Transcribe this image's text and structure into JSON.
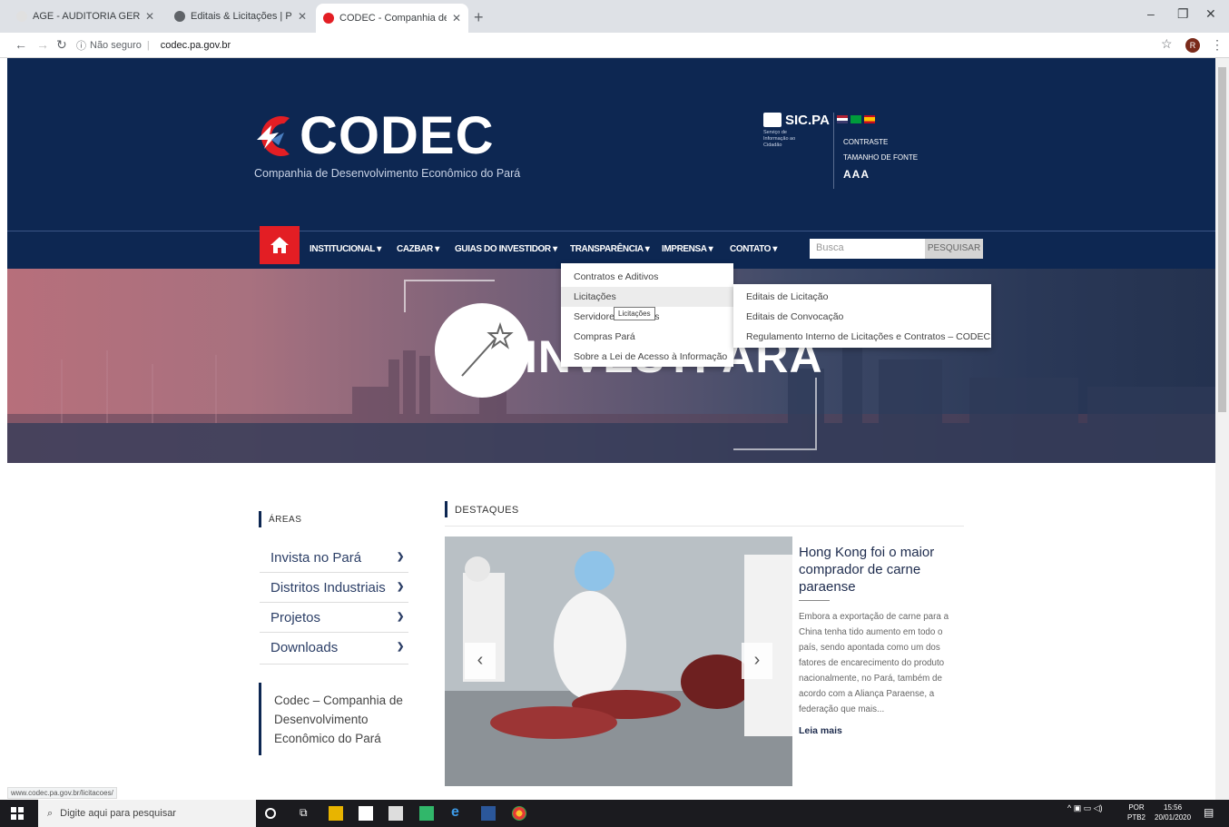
{
  "browser": {
    "tabs": [
      {
        "title": "AGE - AUDITORIA GERAL DO ES"
      },
      {
        "title": "Editais & Licitações | Portal da Tr"
      },
      {
        "title": "CODEC - Companhia de Desenv"
      }
    ],
    "insecure_label": "Não seguro",
    "url": "codec.pa.gov.br",
    "profile_initial": "R",
    "status_url": "www.codec.pa.gov.br/licitacoes/"
  },
  "header": {
    "logo_text": "CODEC",
    "logo_subtitle": "Companhia de Desenvolvimento Econômico do Pará",
    "sic_title": "SIC.PA",
    "sic_sub": "Serviço de Informação ao Cidadão",
    "contrast_label": "CONTRASTE",
    "fontsize_label": "TAMANHO DE FONTE",
    "font_aa": "AAA"
  },
  "nav": {
    "items": [
      {
        "label": "INSTITUCIONAL"
      },
      {
        "label": "CAZBAR"
      },
      {
        "label": "GUIAS DO INVESTIDOR"
      },
      {
        "label": "TRANSPARÊNCIA"
      },
      {
        "label": "IMPRENSA"
      },
      {
        "label": "CONTATO"
      }
    ],
    "search_placeholder": "Busca",
    "search_button": "PESQUISAR"
  },
  "dropdown": {
    "items": [
      {
        "label": "Contratos e Aditivos"
      },
      {
        "label": "Licitações"
      },
      {
        "label": "Servidores e Diárias"
      },
      {
        "label": "Compras Pará"
      },
      {
        "label": "Sobre a Lei de Acesso à Informação"
      }
    ],
    "submenu": [
      {
        "label": "Editais de Licitação"
      },
      {
        "label": "Editais de Convocação"
      },
      {
        "label": "Regulamento Interno de Licitações e Contratos – CODEC"
      }
    ],
    "tooltip": "Licitações"
  },
  "hero": {
    "text": "INVESTPARÁ"
  },
  "areas": {
    "title": "ÁREAS",
    "items": [
      {
        "label": "Invista no Pará"
      },
      {
        "label": "Distritos Industriais"
      },
      {
        "label": "Projetos"
      },
      {
        "label": "Downloads"
      }
    ],
    "box_text": "Codec – Companhia de Desenvolvimento Econômico do Pará"
  },
  "destaques": {
    "title": "DESTAQUES",
    "news_title": "Hong Kong foi o maior comprador de carne paraense",
    "news_body": "Embora a exportação de carne para a China tenha tido aumento em todo o país, sendo apontada como um dos fatores de encarecimento do produto nacionalmente, no Pará, também de acordo com a Aliança Paraense, a federação que mais...",
    "read_more": "Leia mais"
  },
  "taskbar": {
    "search_placeholder": "Digite aqui para pesquisar",
    "lang_top": "POR",
    "lang_bottom": "PTB2",
    "time": "15:56",
    "date": "20/01/2020"
  },
  "colors": {
    "brand_navy": "#0d2752",
    "brand_red": "#e31e24"
  }
}
